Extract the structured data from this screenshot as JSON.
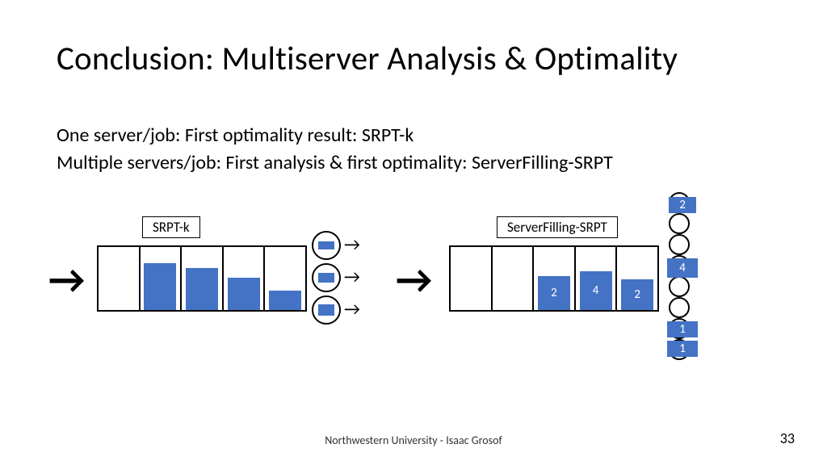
{
  "title": "Conclusion: Multiserver Analysis & Optimality",
  "body": {
    "line1": "One server/job: First optimality result: SRPT-k",
    "line2": "Multiple servers/job: First analysis & first optimality: ServerFilling-SRPT"
  },
  "left": {
    "label": "SRPT-k"
  },
  "right": {
    "label": "ServerFilling-SRPT",
    "jobs": {
      "a": "2",
      "b": "4",
      "c": "2"
    },
    "servers": {
      "top": "2",
      "mid": "4",
      "bot1": "1",
      "bot2": "1"
    }
  },
  "footer": "Northwestern University - Isaac Grosof",
  "page": "33"
}
